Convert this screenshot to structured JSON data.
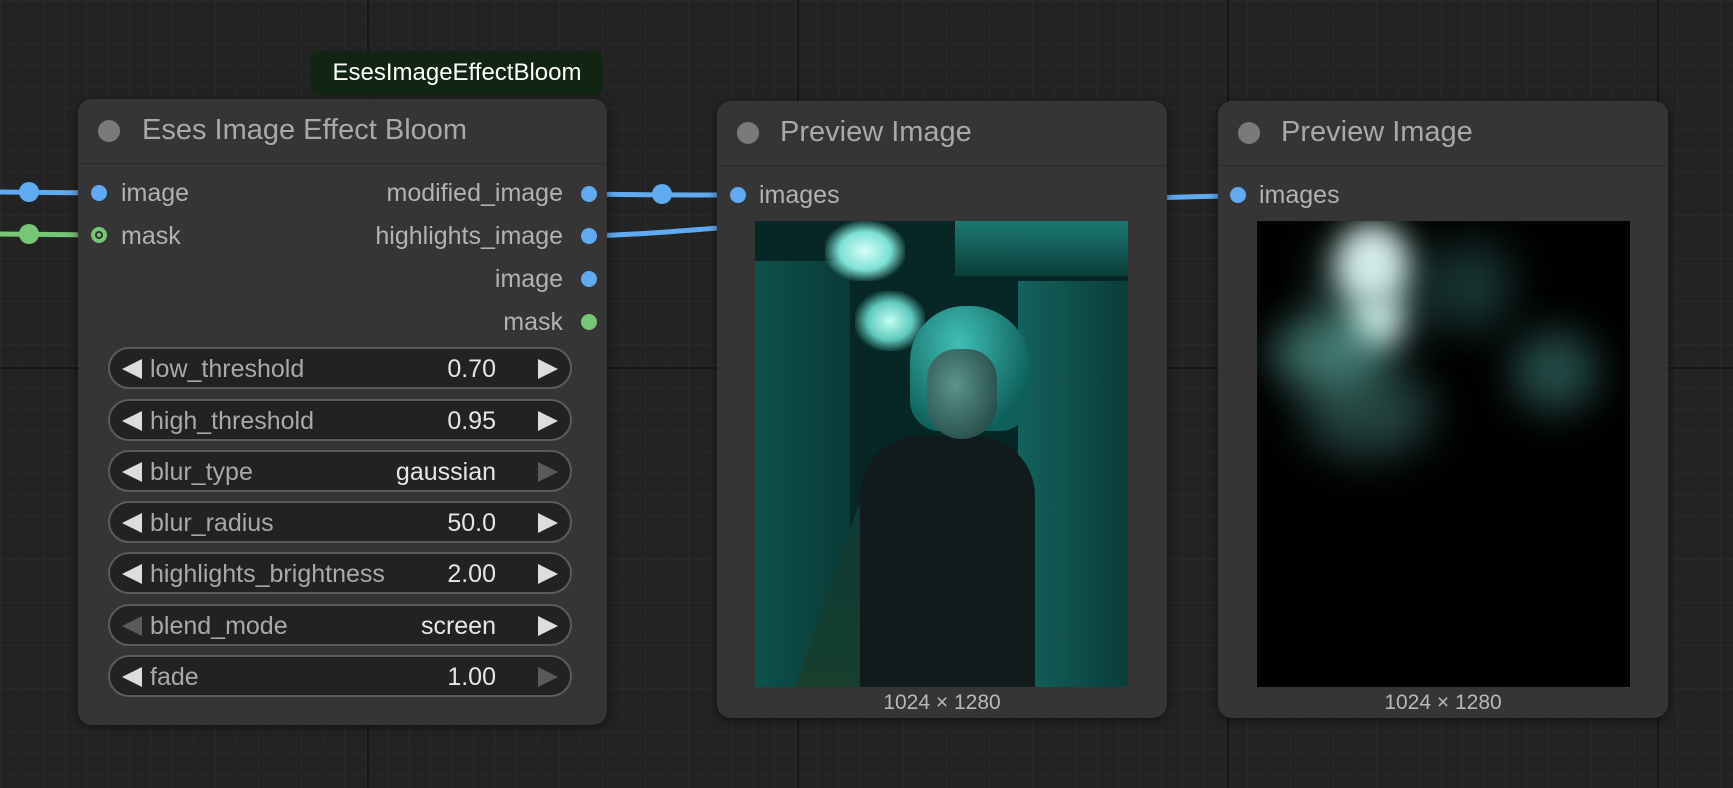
{
  "canvas": {
    "badge": "EsesImageEffectBloom"
  },
  "bloom_node": {
    "title": "Eses Image Effect Bloom",
    "inputs": [
      {
        "label": "image",
        "type": "image"
      },
      {
        "label": "mask",
        "type": "mask"
      }
    ],
    "outputs": [
      {
        "label": "modified_image",
        "type": "image"
      },
      {
        "label": "highlights_image",
        "type": "image"
      },
      {
        "label": "image",
        "type": "image"
      },
      {
        "label": "mask",
        "type": "mask"
      }
    ],
    "widgets": [
      {
        "name": "low_threshold",
        "value": "0.70"
      },
      {
        "name": "high_threshold",
        "value": "0.95"
      },
      {
        "name": "blur_type",
        "value": "gaussian"
      },
      {
        "name": "blur_radius",
        "value": "50.0"
      },
      {
        "name": "highlights_brightness",
        "value": "2.00"
      },
      {
        "name": "blend_mode",
        "value": "screen"
      },
      {
        "name": "fade",
        "value": "1.00"
      }
    ]
  },
  "preview_nodes": [
    {
      "title": "Preview Image",
      "input_label": "images",
      "image_content": "woman in teal-lit train corridor",
      "dimensions": "1024 × 1280"
    },
    {
      "title": "Preview Image",
      "input_label": "images",
      "image_content": "blurred bloom highlights on black",
      "dimensions": "1024 × 1280"
    }
  ],
  "colors": {
    "image_link": "#5faaf0",
    "mask_link": "#76c676",
    "node_bg": "#353535",
    "canvas_bg": "#232323",
    "badge_bg": "#122513"
  }
}
